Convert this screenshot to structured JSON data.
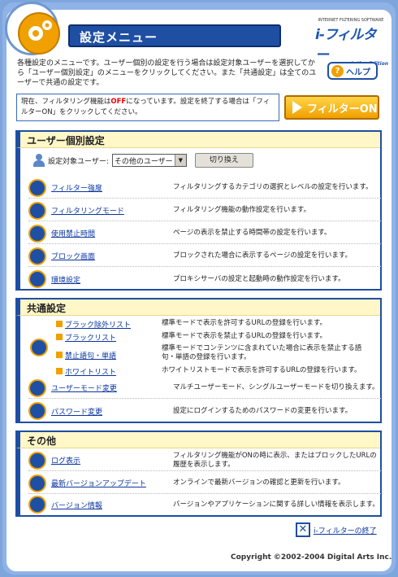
{
  "header": {
    "title": "設定メニュー",
    "logo_small": "INTERNET FILTERING SOFTWARE",
    "logo_main": "i-フィルター",
    "logo_edition": "Active Edition",
    "help_label": "ヘルプ"
  },
  "intro": "各種設定のメニューです。ユーザー個別の設定を行う場合は設定対象ユーザーを選択してから「ユーザー個別設定」のメニューをクリックしてください。また「共通設定」は全てのユーザーで共通の設定です。",
  "status": {
    "text_before": "現在、フィルタリング機能は",
    "off": "OFF",
    "text_after": "になっています。設定を終了する場合は「フィルターON」をクリックしてください。",
    "button": "フィルターON"
  },
  "user_section": {
    "heading": "ユーザー個別設定",
    "target_label": "設定対象ユーザー:",
    "target_value": "その他のユーザー",
    "switch_label": "切り換え",
    "rows": [
      {
        "link": "フィルター強度",
        "desc": "フィルタリングするカテゴリの選択とレベルの設定を行います。"
      },
      {
        "link": "フィルタリングモード",
        "desc": "フィルタリング機能の動作設定を行います。"
      },
      {
        "link": "使用禁止時間",
        "desc": "ページの表示を禁止する時間帯の設定を行います。"
      },
      {
        "link": "ブロック画面",
        "desc": "ブロックされた場合に表示するページの設定を行います。"
      },
      {
        "link": "環境設定",
        "desc": "プロキシサーバの設定と起動時の動作設定を行います。"
      }
    ]
  },
  "common_section": {
    "heading": "共通設定",
    "lists": [
      {
        "link": "ブラック除外リスト",
        "desc": "標準モードで表示を許可するURLの登録を行います。"
      },
      {
        "link": "ブラックリスト",
        "desc": "標準モードで表示を禁止するURLの登録を行います。"
      },
      {
        "link": "禁止語句・単語",
        "desc": "標準モードでコンテンツに含まれていた場合に表示を禁止する語句・単語の登録を行います。"
      },
      {
        "link": "ホワイトリスト",
        "desc": "ホワイトリストモードで表示を許可するURLの登録を行います。"
      }
    ],
    "rows": [
      {
        "link": "ユーザーモード変更",
        "desc": "マルチユーザーモード、シングルユーザーモードを切り換えます。"
      },
      {
        "link": "パスワード変更",
        "desc": "設定にログインするためのパスワードの変更を行います。"
      }
    ]
  },
  "other_section": {
    "heading": "その他",
    "rows": [
      {
        "link": "ログ表示",
        "desc": "フィルタリング機能がONの時に表示、またはブロックしたURLの履歴を表示します。"
      },
      {
        "link": "最新バージョンアップデート",
        "desc": "オンラインで最新バージョンの確認と更新を行います。"
      },
      {
        "link": "バージョン情報",
        "desc": "バージョンやアプリケーションに関する詳しい情報を表示します。"
      }
    ]
  },
  "footer": {
    "exit_label": "i-フィルターの終了",
    "copyright": "Copyright ©2002-2004 Digital Arts Inc."
  }
}
